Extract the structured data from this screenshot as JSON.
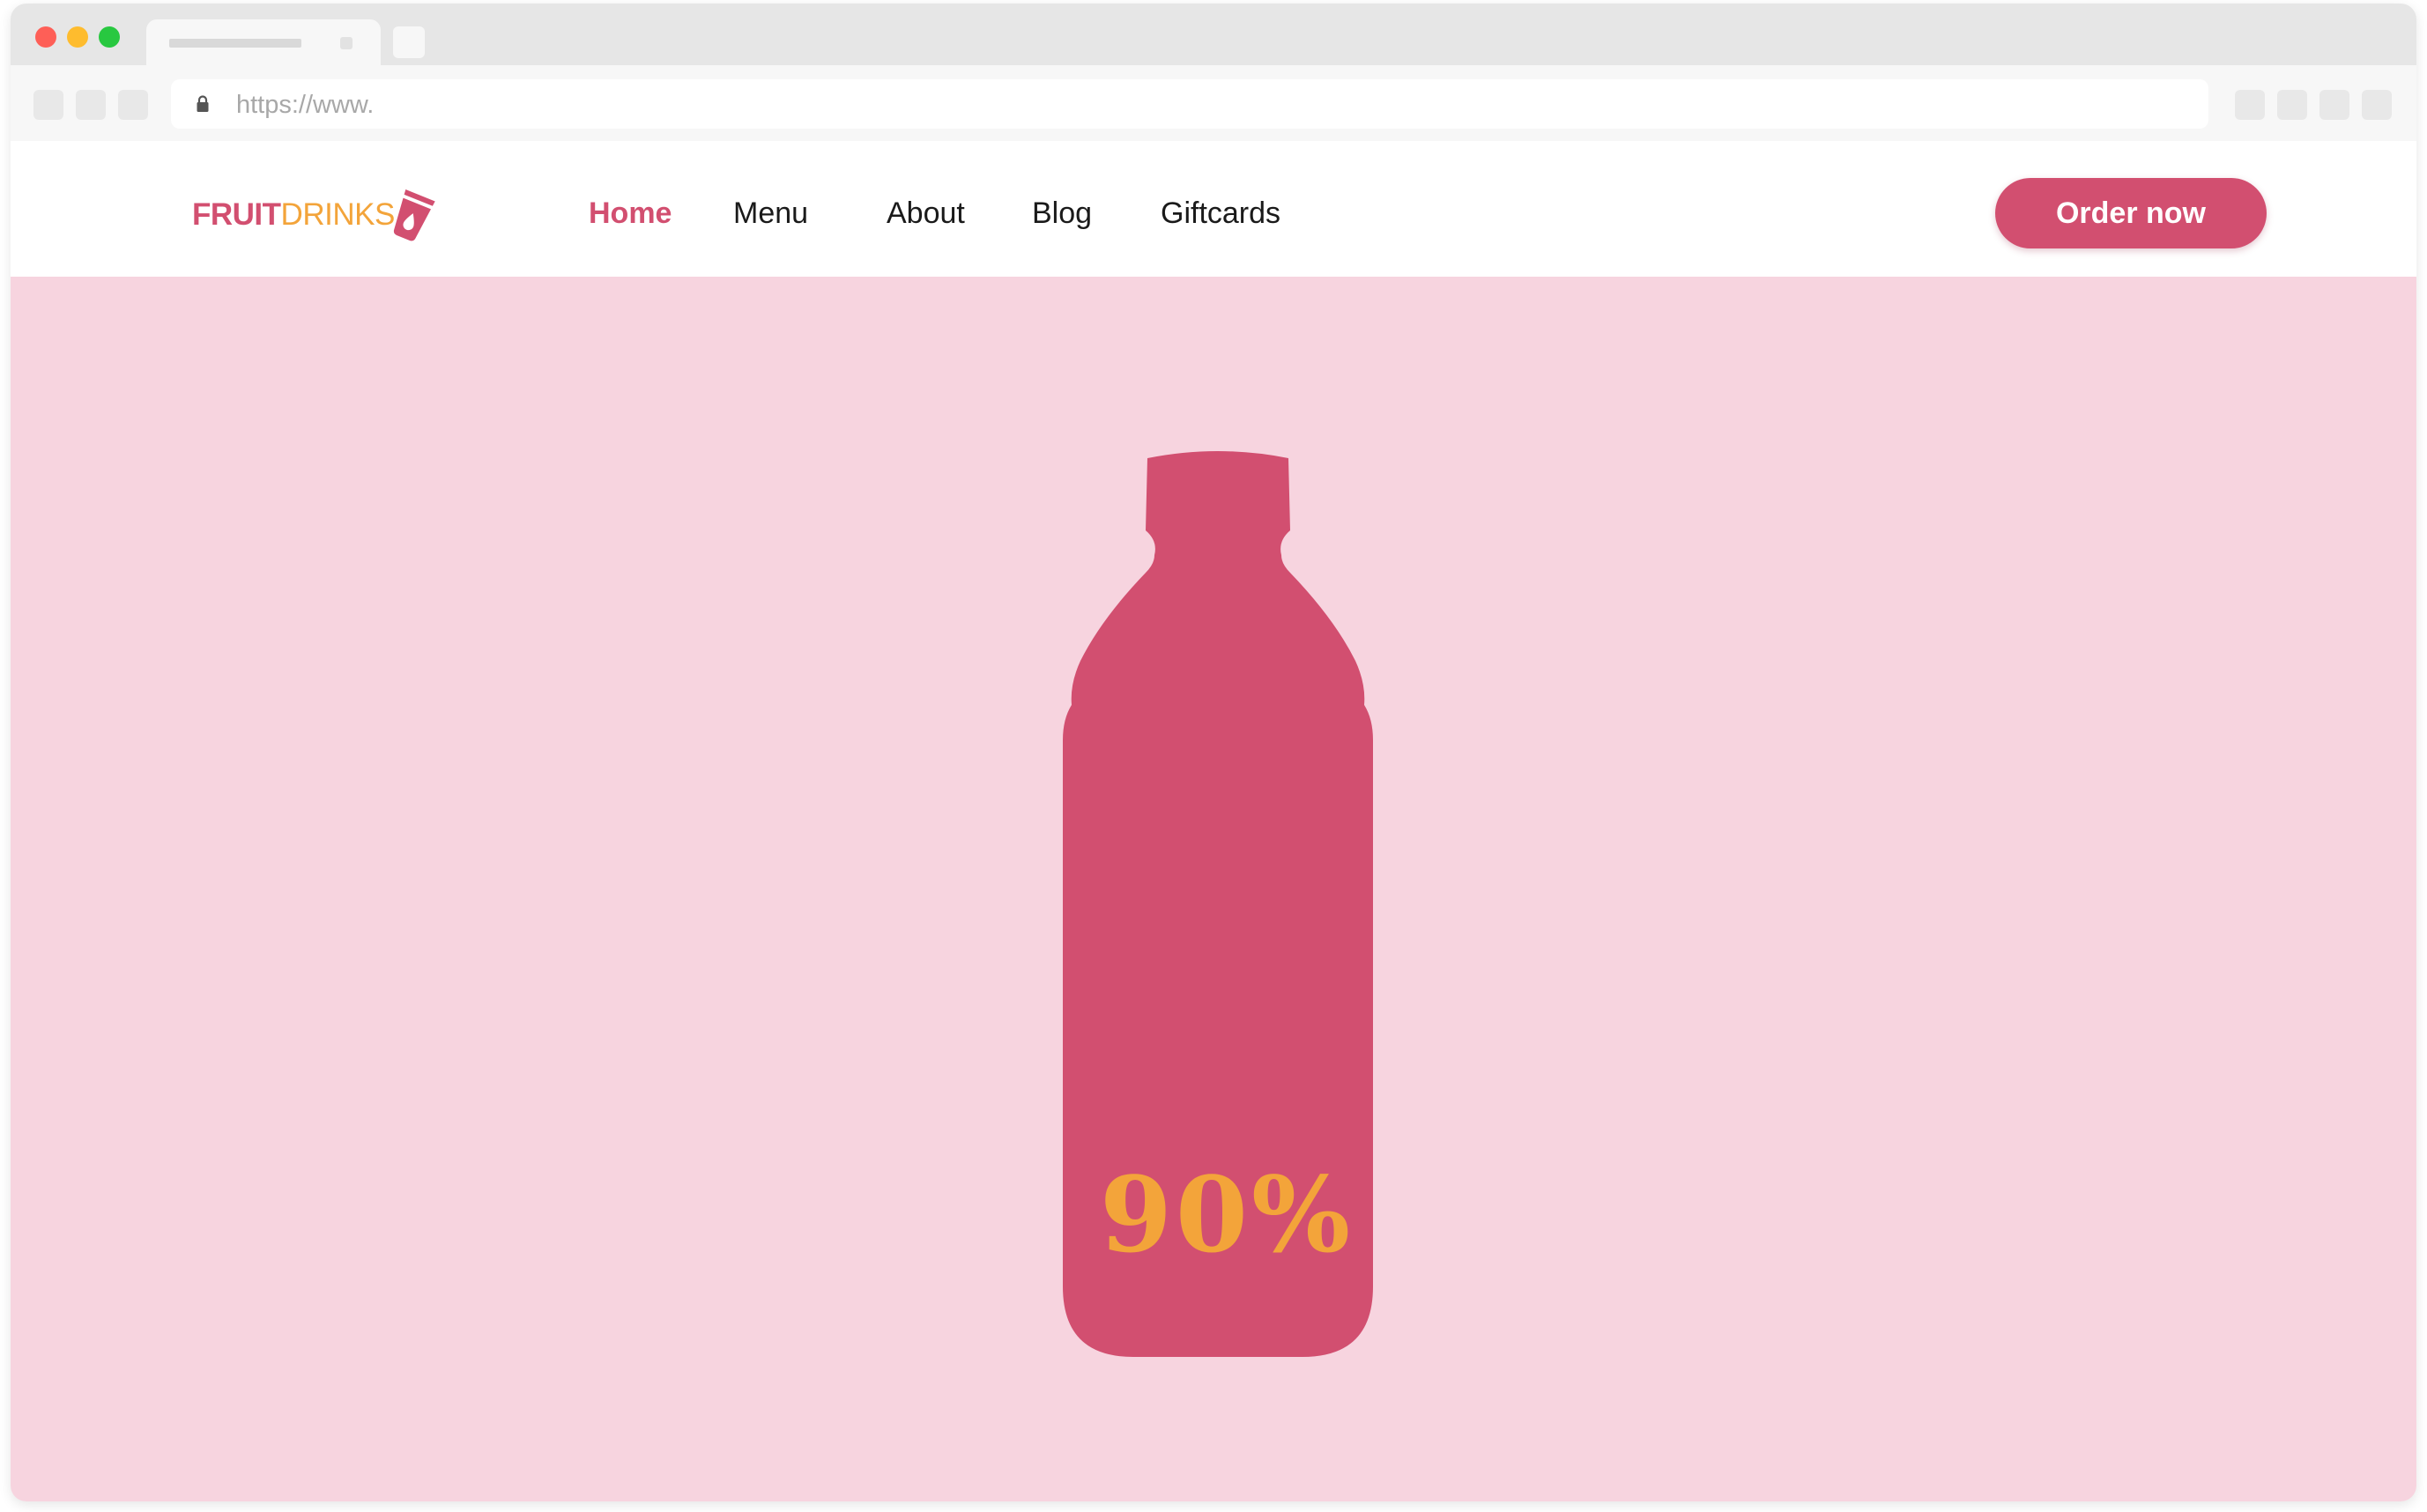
{
  "browser": {
    "url": "https://www.",
    "tab_icon": "tab-placeholder"
  },
  "brand": {
    "part1": "FRUIT",
    "part2": "DRINKS",
    "icon": "cup-icon",
    "colors": {
      "primary": "#d24f70",
      "accent": "#f3a43a",
      "hero_background": "#f7d4df"
    }
  },
  "nav": {
    "items": [
      {
        "label": "Home",
        "active": true
      },
      {
        "label": "Menu",
        "active": false
      },
      {
        "label": "About",
        "active": false
      },
      {
        "label": "Blog",
        "active": false
      },
      {
        "label": "Giftcards",
        "active": false
      }
    ]
  },
  "cta": {
    "label": "Order now"
  },
  "hero": {
    "image": "bottle-icon",
    "percent_label": "90%"
  }
}
